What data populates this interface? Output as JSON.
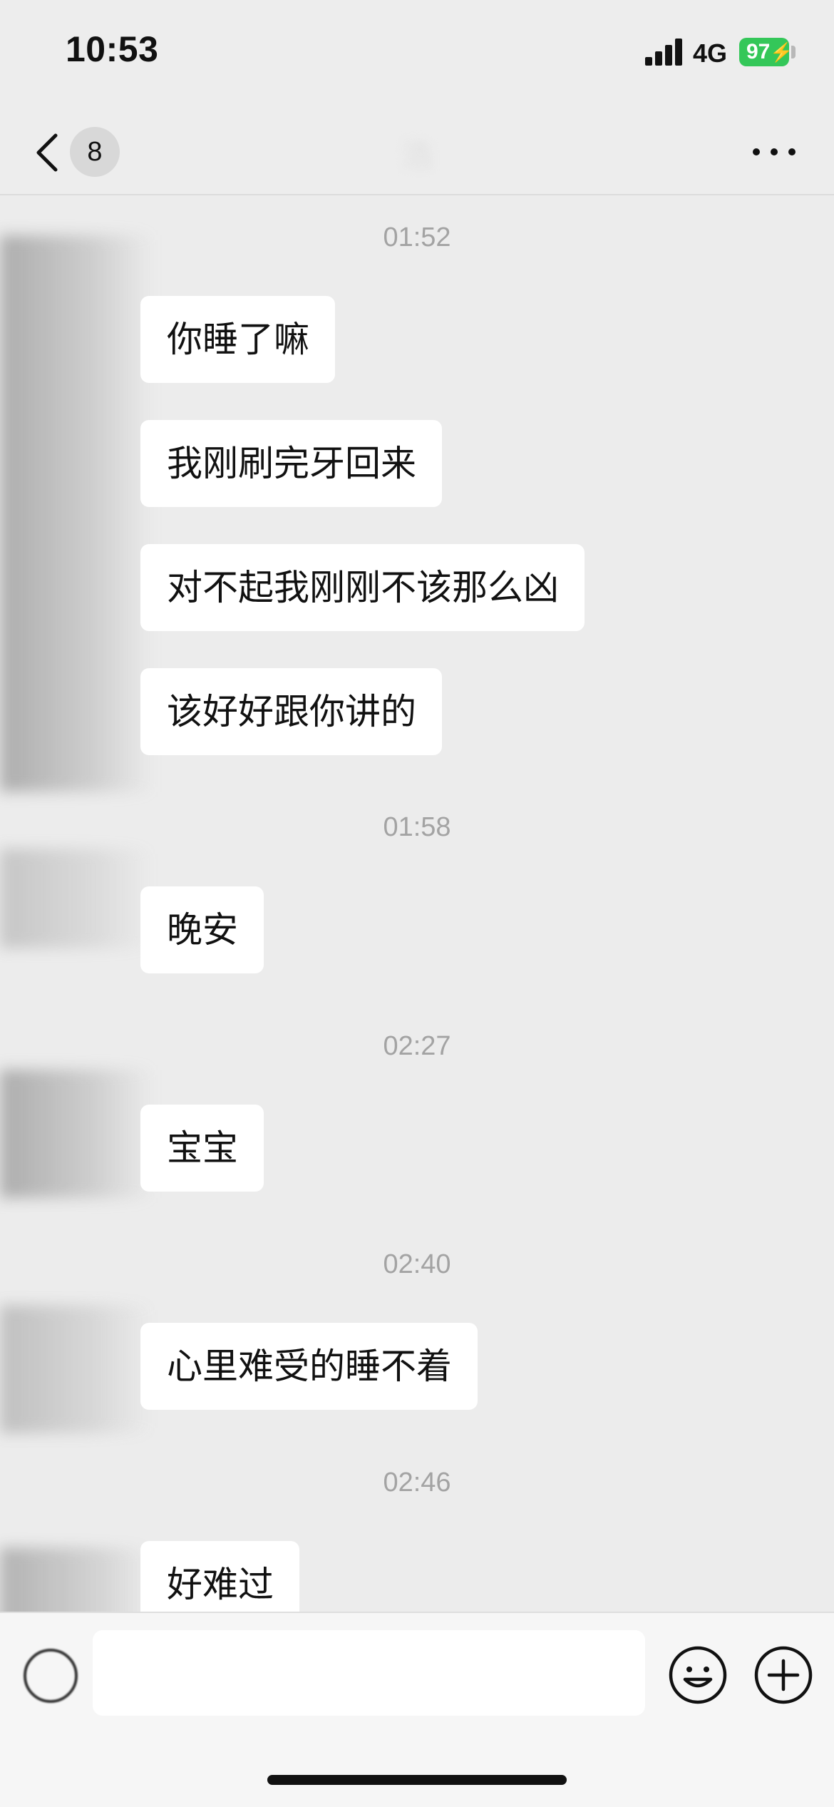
{
  "status_bar": {
    "time": "10:53",
    "network": "4G",
    "battery": "97"
  },
  "nav": {
    "unread_count": "8",
    "title": "浩"
  },
  "messages": [
    {
      "time": "01:52"
    },
    {
      "text": "你睡了嘛"
    },
    {
      "text": "我刚刷完牙回来"
    },
    {
      "text": "对不起我刚刚不该那么凶"
    },
    {
      "text": "该好好跟你讲的"
    },
    {
      "time": "01:58"
    },
    {
      "text": "晚安"
    },
    {
      "time": "02:27"
    },
    {
      "text": "宝宝"
    },
    {
      "time": "02:40"
    },
    {
      "text": "心里难受的睡不着"
    },
    {
      "time": "02:46"
    },
    {
      "text": "好难过"
    }
  ],
  "input": {
    "value": ""
  },
  "colors": {
    "background": "#ececec",
    "bubble": "#ffffff",
    "battery": "#34c759",
    "timestamp": "#a3a3a3"
  },
  "icons": [
    "back-chevron-icon",
    "more-icon",
    "voice-icon",
    "emoji-icon",
    "plus-icon"
  ]
}
